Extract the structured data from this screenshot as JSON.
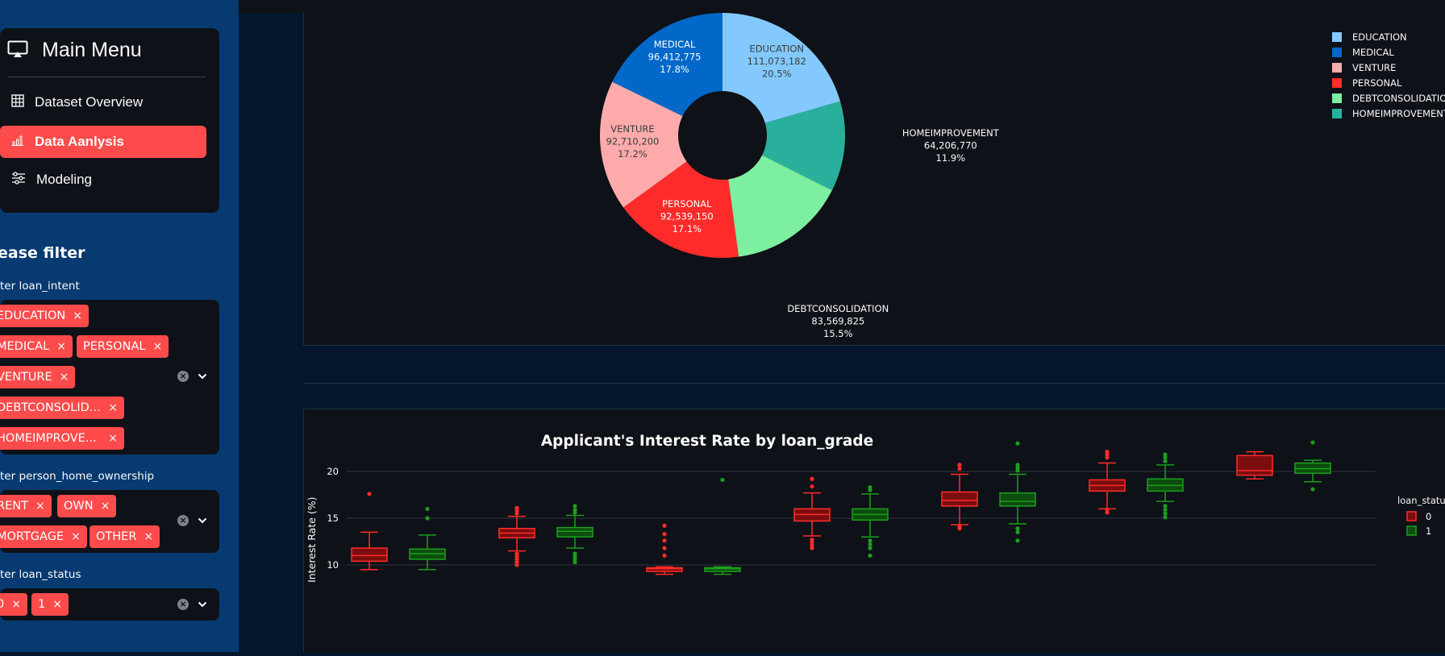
{
  "sidebar": {
    "menu_title": "Main Menu",
    "items": [
      {
        "label": "Dataset Overview",
        "icon": "table-icon",
        "active": false
      },
      {
        "label": "Data Aanlysis",
        "icon": "bar-chart-icon",
        "active": true
      },
      {
        "label": "Modeling",
        "icon": "sliders-icon",
        "active": false
      }
    ],
    "filter_heading": "ease filter",
    "filters": [
      {
        "label": "ter loan_intent",
        "chips": [
          "EDUCATION",
          "MEDICAL",
          "PERSONAL",
          "VENTURE",
          "DEBTCONSOLID...",
          "HOMEIMPROVE..."
        ]
      },
      {
        "label": "ter person_home_ownership",
        "chips": [
          "RENT",
          "OWN",
          "MORTGAGE",
          "OTHER"
        ]
      },
      {
        "label": "ter loan_status",
        "chips": [
          "0",
          "1"
        ]
      }
    ],
    "chip_remove_glyph": "×",
    "clear_glyph": "×"
  },
  "pie": {
    "legend": [
      "EDUCATION",
      "MEDICAL",
      "VENTURE",
      "PERSONAL",
      "DEBTCONSOLIDATION",
      "HOMEIMPROVEMENT"
    ],
    "slices": [
      {
        "name": "EDUCATION",
        "value": "111,073,182",
        "pct": "20.5%",
        "frac": 0.205,
        "color": "#83c9ff"
      },
      {
        "name": "HOMEIMPROVEMENT",
        "value": "64,206,770",
        "pct": "11.9%",
        "frac": 0.119,
        "color": "#29b09d"
      },
      {
        "name": "DEBTCONSOLIDATION",
        "value": "83,569,825",
        "pct": "15.5%",
        "frac": 0.155,
        "color": "#7defa1"
      },
      {
        "name": "PERSONAL",
        "value": "92,539,150",
        "pct": "17.1%",
        "frac": 0.171,
        "color": "#ff2b2b"
      },
      {
        "name": "VENTURE",
        "value": "92,710,200",
        "pct": "17.2%",
        "frac": 0.172,
        "color": "#ffabab"
      },
      {
        "name": "MEDICAL",
        "value": "96,412,775",
        "pct": "17.8%",
        "frac": 0.178,
        "color": "#0068c9"
      }
    ]
  },
  "chart_data": {
    "type": "box",
    "title": "Applicant's Interest Rate by loan_grade",
    "ylabel": "Interest Rate (%)",
    "yticks": [
      10,
      15,
      20
    ],
    "legend_title": "loan_status",
    "series": [
      {
        "name": "0",
        "color": "#ff2b2b",
        "fill": "#7a0d0d"
      },
      {
        "name": "1",
        "color": "#1c9e1c",
        "fill": "#0d4d0d"
      }
    ],
    "groups": [
      {
        "boxes": [
          {
            "status": "0",
            "whislo": 9.5,
            "q1": 10.4,
            "med": 11.0,
            "q3": 11.8,
            "whishi": 13.5,
            "outliers": [
              17.6
            ]
          },
          {
            "status": "1",
            "whislo": 9.5,
            "q1": 10.6,
            "med": 11.2,
            "q3": 11.7,
            "whishi": 13.2,
            "outliers": [
              15.0,
              16.0
            ]
          }
        ]
      },
      {
        "boxes": [
          {
            "status": "0",
            "whislo": 11.5,
            "q1": 12.9,
            "med": 13.4,
            "q3": 13.9,
            "whishi": 15.2,
            "outliers": [
              10.0,
              10.3,
              10.6,
              10.9,
              11.2,
              15.5,
              15.8,
              16.1
            ]
          },
          {
            "status": "1",
            "whislo": 11.8,
            "q1": 13.0,
            "med": 13.6,
            "q3": 14.0,
            "whishi": 15.3,
            "outliers": [
              10.3,
              10.6,
              10.9,
              11.2,
              15.6,
              15.9,
              16.3
            ]
          }
        ]
      },
      {
        "boxes": [
          {
            "status": "0",
            "whislo": 9.0,
            "q1": 9.3,
            "med": 9.6,
            "q3": 9.7,
            "whishi": 9.8,
            "outliers": [
              11.0,
              11.8,
              12.6,
              13.3,
              14.2
            ]
          },
          {
            "status": "1",
            "whislo": 9.0,
            "q1": 9.3,
            "med": 9.6,
            "q3": 9.7,
            "whishi": 9.8,
            "outliers": [
              19.1
            ]
          }
        ]
      },
      {
        "boxes": [
          {
            "status": "0",
            "whislo": 13.1,
            "q1": 14.7,
            "med": 15.4,
            "q3": 16.0,
            "whishi": 17.7,
            "outliers": [
              11.8,
              12.1,
              12.4,
              12.7,
              18.4,
              19.2
            ]
          },
          {
            "status": "1",
            "whislo": 13.0,
            "q1": 14.8,
            "med": 15.4,
            "q3": 16.0,
            "whishi": 17.6,
            "outliers": [
              11.0,
              11.8,
              12.2,
              12.6,
              18.0,
              18.3
            ]
          }
        ]
      },
      {
        "boxes": [
          {
            "status": "0",
            "whislo": 14.3,
            "q1": 16.3,
            "med": 16.9,
            "q3": 17.8,
            "whishi": 19.7,
            "outliers": [
              13.9,
              14.1,
              20.3,
              20.7
            ]
          },
          {
            "status": "1",
            "whislo": 14.4,
            "q1": 16.3,
            "med": 16.8,
            "q3": 17.7,
            "whishi": 19.7,
            "outliers": [
              12.6,
              13.5,
              13.9,
              20.1,
              20.4,
              20.7,
              23.0
            ]
          }
        ]
      },
      {
        "boxes": [
          {
            "status": "0",
            "whislo": 16.0,
            "q1": 17.9,
            "med": 18.5,
            "q3": 19.1,
            "whishi": 20.9,
            "outliers": [
              15.6,
              15.9,
              21.5,
              21.8,
              22.1
            ]
          },
          {
            "status": "1",
            "whislo": 16.8,
            "q1": 17.9,
            "med": 18.5,
            "q3": 19.2,
            "whishi": 20.7,
            "outliers": [
              15.1,
              15.5,
              15.9,
              16.3,
              21.1,
              21.5,
              21.8
            ]
          }
        ]
      },
      {
        "boxes": [
          {
            "status": "0",
            "whislo": 19.2,
            "q1": 19.6,
            "med": 20.1,
            "q3": 21.7,
            "whishi": 22.1,
            "outliers": []
          },
          {
            "status": "1",
            "whislo": 18.9,
            "q1": 19.8,
            "med": 20.3,
            "q3": 20.9,
            "whishi": 21.2,
            "outliers": [
              18.1,
              23.1
            ]
          }
        ]
      }
    ]
  }
}
